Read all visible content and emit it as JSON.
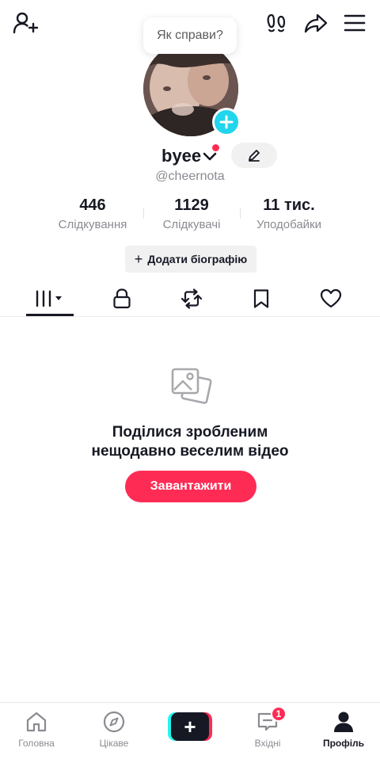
{
  "status_bubble": "Як справи?",
  "profile": {
    "username": "byee",
    "handle": "@cheernota",
    "stats": {
      "following_count": "446",
      "following_label": "Слідкування",
      "followers_count": "1129",
      "followers_label": "Слідкувачі",
      "likes_count": "11 тис.",
      "likes_label": "Уподобайки"
    },
    "add_bio": "Додати біографію"
  },
  "empty_state": {
    "title_line1": "Поділися зробленим",
    "title_line2": "нещодавно веселим відео",
    "upload_button": "Завантажити"
  },
  "bottom_nav": {
    "home": "Головна",
    "discover": "Цікаве",
    "inbox": "Вхідні",
    "inbox_badge": "1",
    "profile": "Профіль"
  },
  "colors": {
    "accent": "#fe2c55",
    "cyan": "#20d5ec",
    "text": "#161823",
    "muted": "#8a8b91"
  },
  "icons": {
    "top_left": "add-friend-icon",
    "top_right": [
      "footprints-icon",
      "share-icon",
      "menu-icon"
    ],
    "tabs": [
      "grid-icon",
      "lock-icon",
      "repost-icon",
      "bookmark-icon",
      "heart-icon"
    ]
  }
}
